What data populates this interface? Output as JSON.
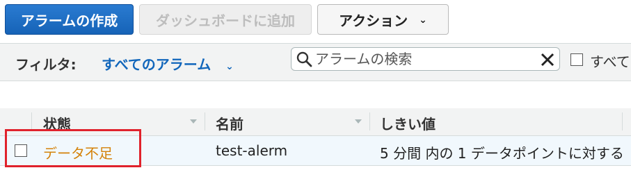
{
  "toolbar": {
    "create_alarm": "アラームの作成",
    "add_to_dashboard": "ダッシュボードに追加",
    "actions": "アクション"
  },
  "filter": {
    "label": "フィルタ:",
    "selected": "すべてのアラーム",
    "search_placeholder": "アラームの検索",
    "all_checkbox_label": "すべて"
  },
  "table": {
    "columns": [
      "状態",
      "名前",
      "しきい値"
    ],
    "rows": [
      {
        "state": "データ不足",
        "name": "test-alerm",
        "threshold": "5 分間 内の 1 データポイントに対する"
      }
    ]
  },
  "colors": {
    "primary_button": "#1663b7",
    "link": "#1166bb",
    "state_insufficient": "#d4820a",
    "highlight": "#e0222c"
  }
}
